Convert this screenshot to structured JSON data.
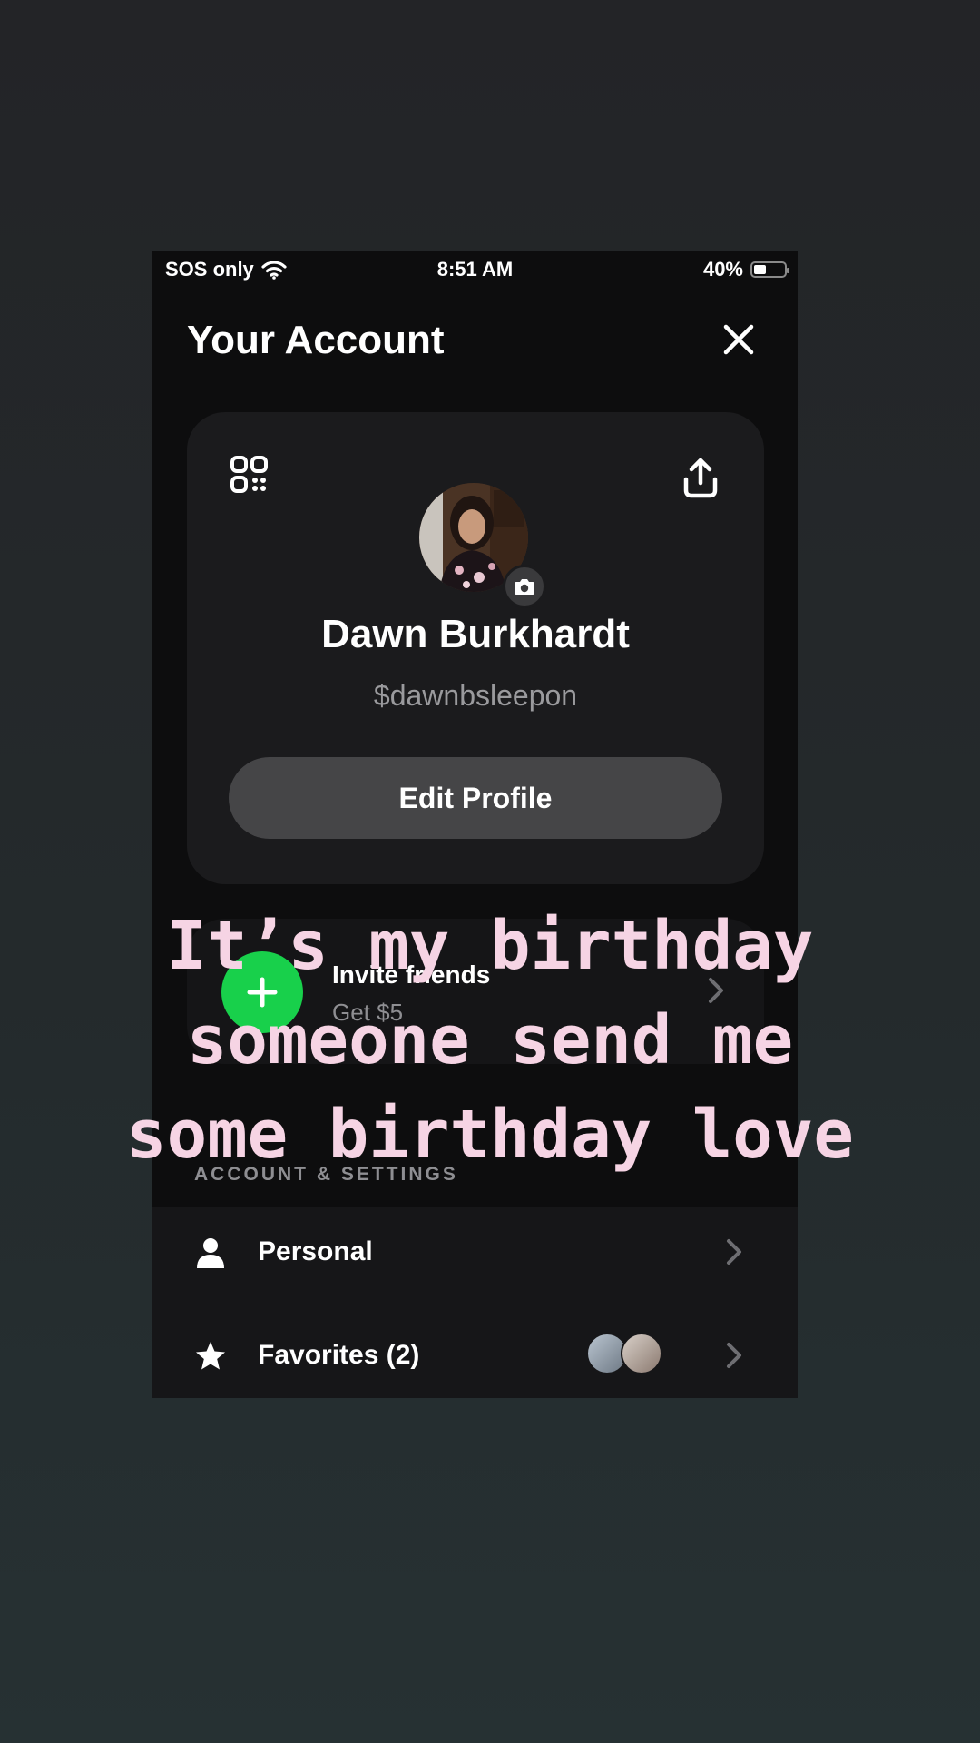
{
  "status_bar": {
    "carrier": "SOS only",
    "time": "8:51 AM",
    "battery_percent": "40%",
    "battery_level": 0.4
  },
  "header": {
    "title": "Your Account"
  },
  "profile": {
    "name": "Dawn Burkhardt",
    "cashtag": "$dawnbsleepon",
    "edit_label": "Edit Profile"
  },
  "invite": {
    "title": "Invite friends",
    "subtitle": "Get $5"
  },
  "settings": {
    "section_title": "ACCOUNT & SETTINGS",
    "items": [
      {
        "label": "Personal",
        "icon": "person-icon"
      },
      {
        "label": "Favorites (2)",
        "icon": "star-icon"
      }
    ]
  },
  "overlay_text": {
    "line1": "It’s my birthday",
    "line2": "someone send me",
    "line3": "some birthday love"
  },
  "colors": {
    "accent_green": "#18d04b",
    "overlay_pink": "#f6d4e4",
    "card_bg": "#1b1b1d"
  }
}
